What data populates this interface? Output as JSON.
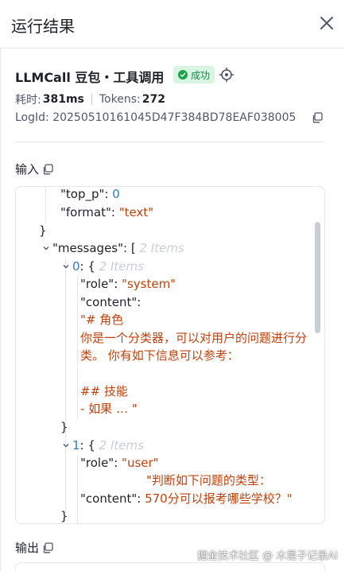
{
  "header": {
    "title": "运行结果"
  },
  "node": {
    "title": "LLMCall 豆包・工具调用",
    "status": "成功",
    "status_color": "#1ca24f",
    "elapsed_label": "耗时:",
    "elapsed_value": "381ms",
    "tokens_label": "Tokens:",
    "tokens_value": "272",
    "logid": "LogId: 20250510161045D47F384BD78EAF038005"
  },
  "input_section": {
    "label": "输入"
  },
  "output_section": {
    "label": "输出"
  },
  "code": {
    "top_p_key": "\"top_p\"",
    "top_p_val": "0",
    "format_key": "\"format\"",
    "format_val": "\"text\"",
    "messages_key": "\"messages\"",
    "messages_meta": "2 Items",
    "m0_index": "0",
    "m0_meta": "2 Items",
    "m0_role_key": "\"role\"",
    "m0_role_val": "\"system\"",
    "m0_content_key": "\"content\"",
    "m0_content_l1": "\"# 角色",
    "m0_content_l2": "你是一个分类器，可以对用户的问题进行分",
    "m0_content_l3": "类。 你有如下信息可以参考：",
    "m0_content_l4": "## 技能",
    "m0_content_l5": "- 如果 … \"",
    "m1_index": "1",
    "m1_meta": "2 Items",
    "m1_role_key": "\"role\"",
    "m1_role_val": "\"user\"",
    "m1_content_key": "\"content\"",
    "m1_content_l1": "\"判断如下问题的类型：",
    "m1_content_l2": "570分可以报考哪些学校？\""
  },
  "watermark": "掘金技术社区 @ 木昆子记录AI"
}
